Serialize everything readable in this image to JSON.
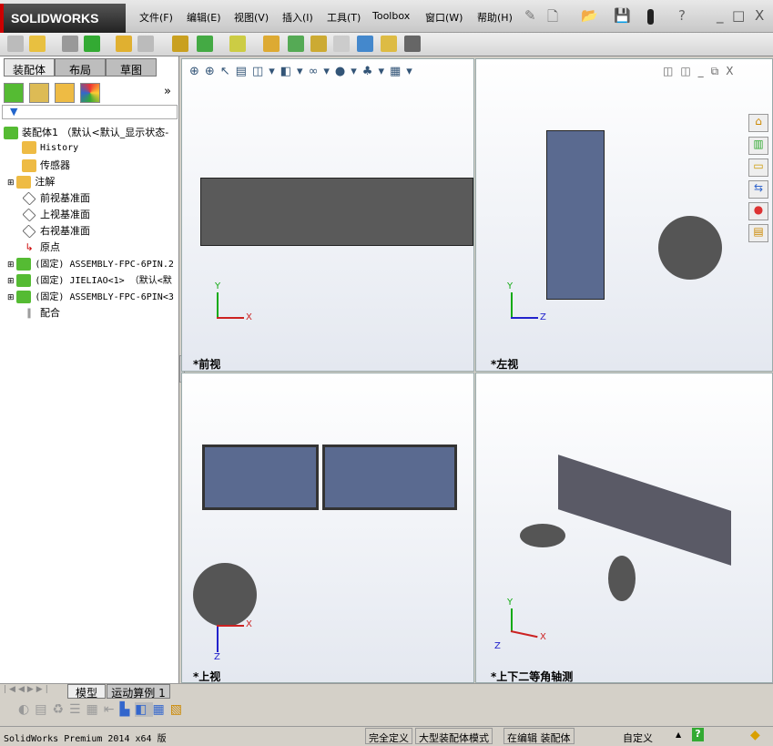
{
  "app": {
    "logo": "SOLIDWORKS"
  },
  "menu": [
    "文件(F)",
    "编辑(E)",
    "视图(V)",
    "插入(I)",
    "工具(T)",
    "Toolbox",
    "窗口(W)",
    "帮助(H)"
  ],
  "window_controls": {
    "help": "?",
    "minimize": "_",
    "restore": "□",
    "close": "X"
  },
  "left_panel": {
    "tabs": [
      "装配体",
      "布局",
      "草图"
    ],
    "expand": "»",
    "tree": [
      {
        "label": "装配体1 （默认<默认_显示状态-",
        "icon": "assembly-icon"
      },
      {
        "label": "History",
        "icon": "history-icon"
      },
      {
        "label": "传感器",
        "icon": "sensor-icon"
      },
      {
        "label": "注解",
        "icon": "annotation-icon"
      },
      {
        "label": "前视基准面",
        "icon": "plane-icon"
      },
      {
        "label": "上视基准面",
        "icon": "plane-icon"
      },
      {
        "label": "右视基准面",
        "icon": "plane-icon"
      },
      {
        "label": "原点",
        "icon": "origin-icon"
      },
      {
        "label": "(固定) ASSEMBLY-FPC-6PIN.2",
        "icon": "assembly-icon"
      },
      {
        "label": "(固定) JIELIAO<1> （默认<默",
        "icon": "assembly-icon"
      },
      {
        "label": "(固定) ASSEMBLY-FPC-6PIN<3",
        "icon": "assembly-icon"
      },
      {
        "label": "配合",
        "icon": "mates-icon"
      }
    ]
  },
  "viewports": [
    {
      "label": "*前视",
      "axes": [
        "Y",
        "X"
      ]
    },
    {
      "label": "*左视",
      "axes": [
        "Y",
        "Z"
      ]
    },
    {
      "label": "*上视",
      "axes": [
        "X",
        "Z"
      ]
    },
    {
      "label": "*上下二等角轴测",
      "axes": [
        "Y",
        "X",
        "Z"
      ]
    }
  ],
  "bottom_tabs": [
    "模型",
    "运动算例 1"
  ],
  "status": {
    "product": "SolidWorks Premium 2014 x64 版",
    "definition": "完全定义",
    "mode": "大型装配体模式",
    "editing": "在编辑 装配体",
    "units": "自定义",
    "help": "?"
  }
}
